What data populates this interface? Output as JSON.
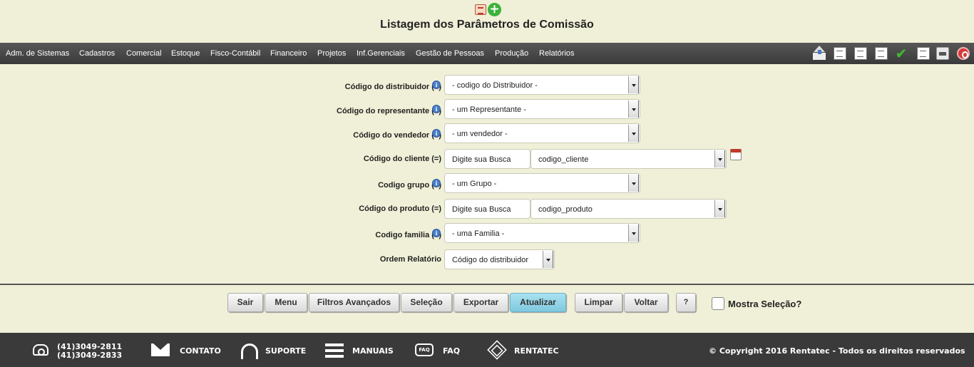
{
  "header": {
    "title": "Listagem dos Parâmetros de Comissão",
    "icons": [
      "report-icon",
      "add-icon"
    ]
  },
  "menu": {
    "items": [
      "Adm. de Sistemas",
      "Cadastros",
      "Comercial",
      "Estoque",
      "Fisco-Contábil",
      "Financeiro",
      "Projetos",
      "Inf.Gerenciais",
      "Gestão de Pessoas",
      "Produção",
      "Relatórios"
    ],
    "toolbar_icons": [
      "home-icon",
      "edit-icon",
      "document-edit-icon",
      "export-icon",
      "check-icon",
      "new-document-icon",
      "print-icon",
      "power-icon"
    ]
  },
  "form": {
    "distribuidor": {
      "label": "Código do distribuidor (=)",
      "value": "- codigo do Distribuidor -"
    },
    "representante": {
      "label": "Código do representante (=)",
      "value": "- um Representante -"
    },
    "vendedor": {
      "label": "Código do vendedor (=)",
      "value": "- um vendedor -"
    },
    "cliente": {
      "label": "Código do cliente (=)",
      "search": "Digite sua Busca",
      "value": "codigo_cliente"
    },
    "grupo": {
      "label": "Codigo grupo (=)",
      "value": "- um Grupo -"
    },
    "produto": {
      "label": "Código do produto (=)",
      "search": "Digite sua Busca",
      "value": "codigo_produto"
    },
    "familia": {
      "label": "Codigo familia (=)",
      "value": "- uma Familia -"
    },
    "ordem": {
      "label": "Ordem Relatório",
      "value": "Código do distribuidor"
    },
    "info_glyph": "i"
  },
  "buttons": {
    "sair": "Sair",
    "menu": "Menu",
    "filtros": "Filtros Avançados",
    "selecao": "Seleção",
    "exportar": "Exportar",
    "atualizar": "Atualizar",
    "limpar": "Limpar",
    "voltar": "Voltar",
    "help": "?",
    "mostra_selecao": "Mostra Seleção?"
  },
  "footer": {
    "phone1": "(41)3049-2811",
    "phone2": "(41)3049-2833",
    "contato": "CONTATO",
    "suporte": "SUPORTE",
    "manuais": "MANUAIS",
    "faq": "FAQ",
    "faq_icon_text": "FAQ",
    "rentatec": "RENTATEC",
    "copyright": "© Copyright 2016 Rentatec - Todos os direitos reservados"
  },
  "colors": {
    "background": "#f0f0d8",
    "menubar": "#3a3a3a",
    "primary_button": "#8fd3e6",
    "info_icon": "#4b7fc8"
  }
}
